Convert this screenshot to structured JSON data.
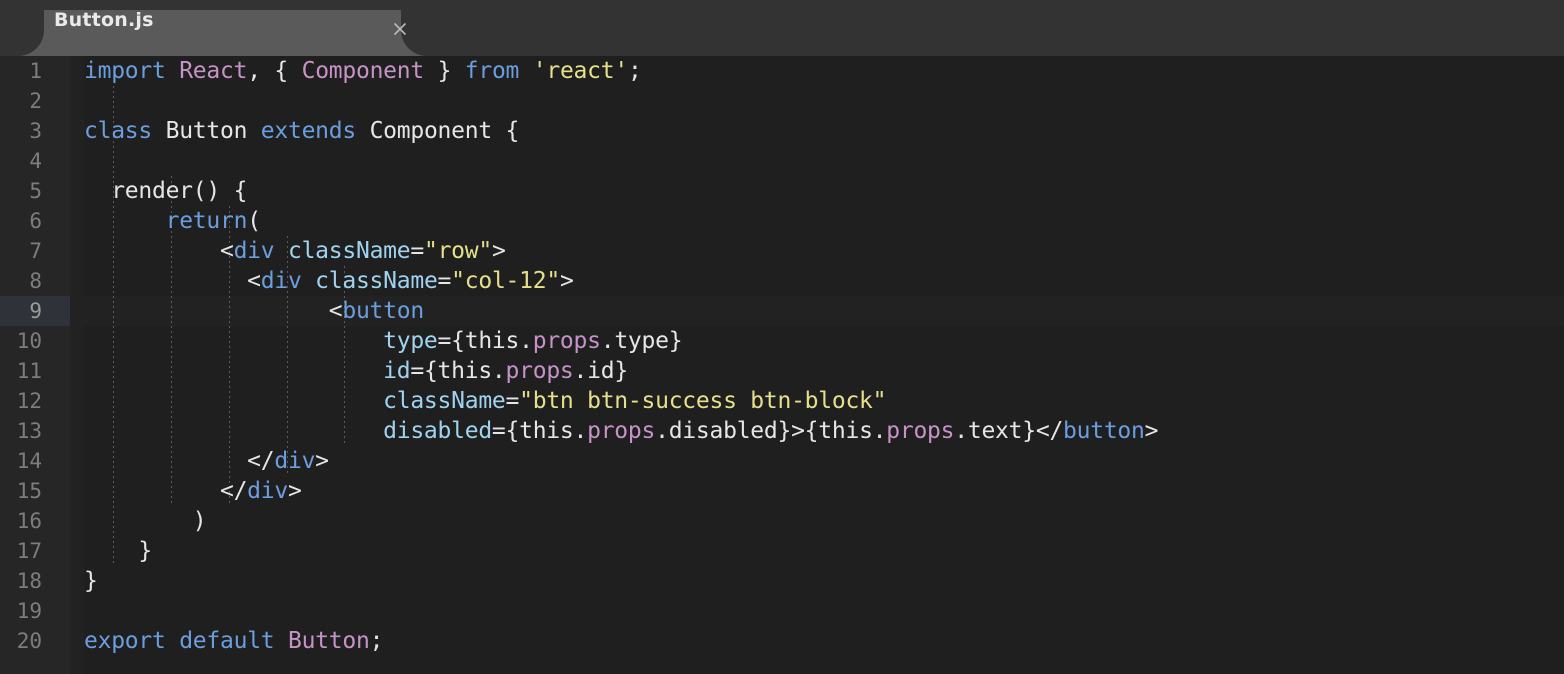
{
  "window": {
    "title": "Button.js",
    "tabbar_bg": "#333333",
    "tab_bg": "#5a5a5a",
    "editor_bg": "#1f1f1f",
    "gutter_bg": "#262626"
  },
  "tab": {
    "label": "Button.js",
    "close_icon": "close-icon",
    "active": true
  },
  "editor": {
    "language": "javascript-jsx",
    "active_line": 9,
    "font_size_px": 23,
    "line_height_px": 30,
    "indent_guide_columns": [
      2,
      6,
      10,
      14,
      18
    ],
    "theme_colors": {
      "keyword": "#6a9ede",
      "entity": "#c792c7",
      "string": "#e5e08a",
      "attribute": "#9fd3ef",
      "tag": "#6a9ede",
      "plain": "#e6e6e6",
      "line_number": "#7d7d7d",
      "active_line_number_bg": "#2f3238"
    },
    "line_numbers": [
      1,
      2,
      3,
      4,
      5,
      6,
      7,
      8,
      9,
      10,
      11,
      12,
      13,
      14,
      15,
      16,
      17,
      18,
      19,
      20
    ],
    "lines": [
      {
        "n": 1,
        "text": "import React, { Component } from 'react';",
        "tokens": [
          {
            "t": "import",
            "c": "t-kw"
          },
          {
            "t": " ",
            "c": "t-plain"
          },
          {
            "t": "React",
            "c": "t-ent"
          },
          {
            "t": ", { ",
            "c": "t-plain"
          },
          {
            "t": "Component",
            "c": "t-ent"
          },
          {
            "t": " } ",
            "c": "t-plain"
          },
          {
            "t": "from",
            "c": "t-kw"
          },
          {
            "t": " ",
            "c": "t-plain"
          },
          {
            "t": "'react'",
            "c": "t-str"
          },
          {
            "t": ";",
            "c": "t-plain"
          }
        ]
      },
      {
        "n": 2,
        "text": "",
        "tokens": []
      },
      {
        "n": 3,
        "text": "class Button extends Component {",
        "tokens": [
          {
            "t": "class",
            "c": "t-kw"
          },
          {
            "t": " Button ",
            "c": "t-plain"
          },
          {
            "t": "extends",
            "c": "t-kw"
          },
          {
            "t": " Component {",
            "c": "t-plain"
          }
        ]
      },
      {
        "n": 4,
        "text": "",
        "tokens": []
      },
      {
        "n": 5,
        "text": "  render() {",
        "tokens": [
          {
            "t": "  render() {",
            "c": "t-plain"
          }
        ]
      },
      {
        "n": 6,
        "text": "      return(",
        "tokens": [
          {
            "t": "      ",
            "c": "t-plain"
          },
          {
            "t": "return",
            "c": "t-kw"
          },
          {
            "t": "(",
            "c": "t-plain"
          }
        ]
      },
      {
        "n": 7,
        "text": "          <div className=\"row\">",
        "tokens": [
          {
            "t": "          <",
            "c": "t-plain"
          },
          {
            "t": "div",
            "c": "t-tag"
          },
          {
            "t": " ",
            "c": "t-plain"
          },
          {
            "t": "className",
            "c": "t-attr"
          },
          {
            "t": "=",
            "c": "t-plain"
          },
          {
            "t": "\"row\"",
            "c": "t-str"
          },
          {
            "t": ">",
            "c": "t-plain"
          }
        ]
      },
      {
        "n": 8,
        "text": "            <div className=\"col-12\">",
        "tokens": [
          {
            "t": "            <",
            "c": "t-plain"
          },
          {
            "t": "div",
            "c": "t-tag"
          },
          {
            "t": " ",
            "c": "t-plain"
          },
          {
            "t": "className",
            "c": "t-attr"
          },
          {
            "t": "=",
            "c": "t-plain"
          },
          {
            "t": "\"col-12\"",
            "c": "t-str"
          },
          {
            "t": ">",
            "c": "t-plain"
          }
        ]
      },
      {
        "n": 9,
        "text": "                  <button",
        "tokens": [
          {
            "t": "                  <",
            "c": "t-plain"
          },
          {
            "t": "button",
            "c": "t-tag"
          }
        ]
      },
      {
        "n": 10,
        "text": "                      type={this.props.type}",
        "tokens": [
          {
            "t": "                      ",
            "c": "t-plain"
          },
          {
            "t": "type",
            "c": "t-attr"
          },
          {
            "t": "={this.",
            "c": "t-plain"
          },
          {
            "t": "props",
            "c": "t-prop"
          },
          {
            "t": ".type}",
            "c": "t-plain"
          }
        ]
      },
      {
        "n": 11,
        "text": "                      id={this.props.id}",
        "tokens": [
          {
            "t": "                      ",
            "c": "t-plain"
          },
          {
            "t": "id",
            "c": "t-attr"
          },
          {
            "t": "={this.",
            "c": "t-plain"
          },
          {
            "t": "props",
            "c": "t-prop"
          },
          {
            "t": ".id}",
            "c": "t-plain"
          }
        ]
      },
      {
        "n": 12,
        "text": "                      className=\"btn btn-success btn-block\"",
        "tokens": [
          {
            "t": "                      ",
            "c": "t-plain"
          },
          {
            "t": "className",
            "c": "t-attr"
          },
          {
            "t": "=",
            "c": "t-plain"
          },
          {
            "t": "\"btn btn-success btn-block\"",
            "c": "t-str"
          }
        ]
      },
      {
        "n": 13,
        "text": "                      disabled={this.props.disabled}>{this.props.text}</button>",
        "tokens": [
          {
            "t": "                      ",
            "c": "t-plain"
          },
          {
            "t": "disabled",
            "c": "t-attr"
          },
          {
            "t": "={this.",
            "c": "t-plain"
          },
          {
            "t": "props",
            "c": "t-prop"
          },
          {
            "t": ".disabled}>{this.",
            "c": "t-plain"
          },
          {
            "t": "props",
            "c": "t-prop"
          },
          {
            "t": ".text}</",
            "c": "t-plain"
          },
          {
            "t": "button",
            "c": "t-tag"
          },
          {
            "t": ">",
            "c": "t-plain"
          }
        ]
      },
      {
        "n": 14,
        "text": "            </div>",
        "tokens": [
          {
            "t": "            </",
            "c": "t-plain"
          },
          {
            "t": "div",
            "c": "t-tag"
          },
          {
            "t": ">",
            "c": "t-plain"
          }
        ]
      },
      {
        "n": 15,
        "text": "          </div>",
        "tokens": [
          {
            "t": "          </",
            "c": "t-plain"
          },
          {
            "t": "div",
            "c": "t-tag"
          },
          {
            "t": ">",
            "c": "t-plain"
          }
        ]
      },
      {
        "n": 16,
        "text": "        )",
        "tokens": [
          {
            "t": "        )",
            "c": "t-plain"
          }
        ]
      },
      {
        "n": 17,
        "text": "    }",
        "tokens": [
          {
            "t": "    }",
            "c": "t-plain"
          }
        ]
      },
      {
        "n": 18,
        "text": "}",
        "tokens": [
          {
            "t": "}",
            "c": "t-plain"
          }
        ]
      },
      {
        "n": 19,
        "text": "",
        "tokens": []
      },
      {
        "n": 20,
        "text": "export default Button;",
        "tokens": [
          {
            "t": "export",
            "c": "t-kw"
          },
          {
            "t": " ",
            "c": "t-plain"
          },
          {
            "t": "default",
            "c": "t-kw"
          },
          {
            "t": " ",
            "c": "t-plain"
          },
          {
            "t": "Button",
            "c": "t-ent"
          },
          {
            "t": ";",
            "c": "t-plain"
          }
        ]
      }
    ]
  }
}
